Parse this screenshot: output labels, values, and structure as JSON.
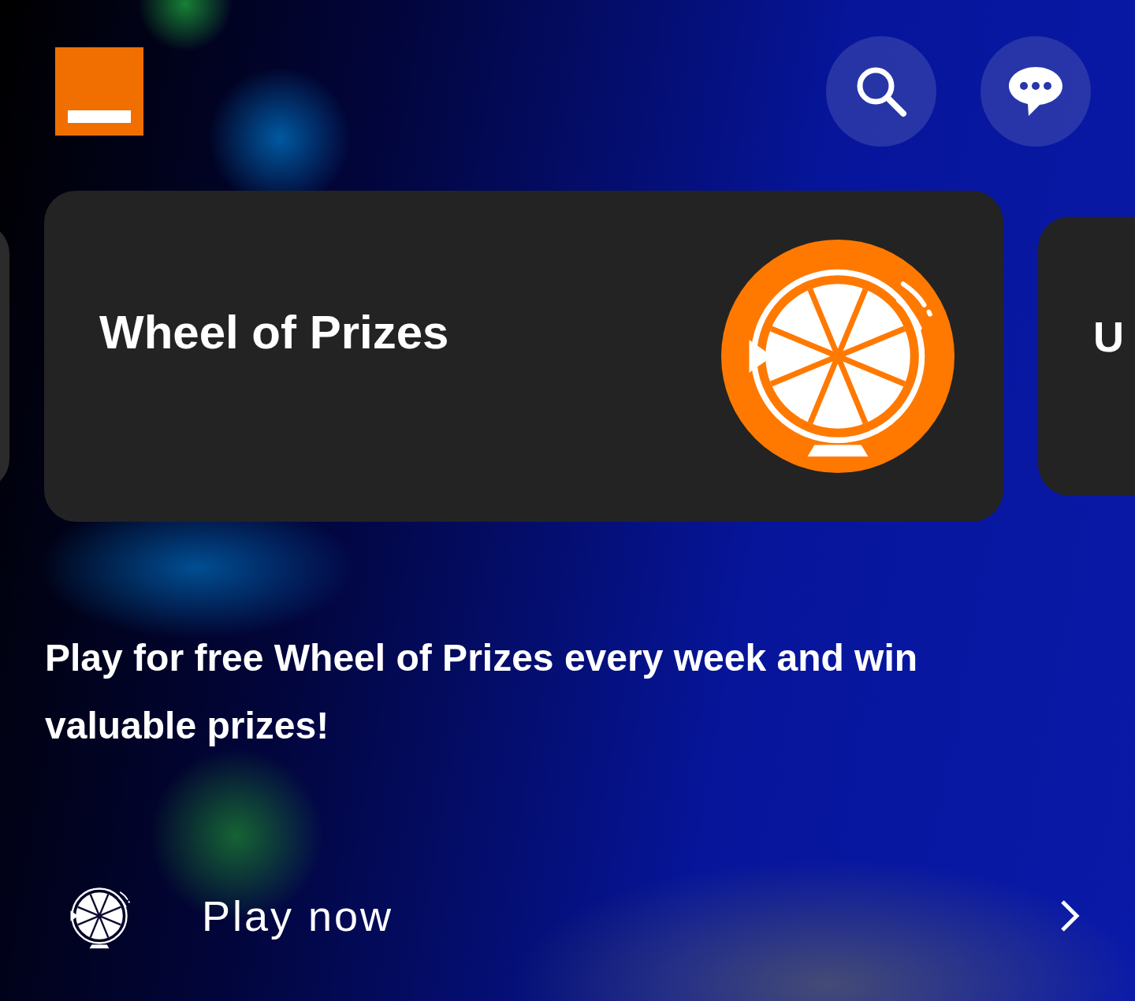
{
  "header": {
    "buttons": [
      {
        "kind": "search"
      },
      {
        "kind": "chat"
      }
    ]
  },
  "cards": [
    {
      "title": "Wheel of Prizes",
      "kind": "wheel"
    },
    {
      "title": "U",
      "kind": "peek"
    }
  ],
  "description": "Play for free Wheel of Prizes every week and win valuable prizes!",
  "action": {
    "label": "Play now"
  }
}
